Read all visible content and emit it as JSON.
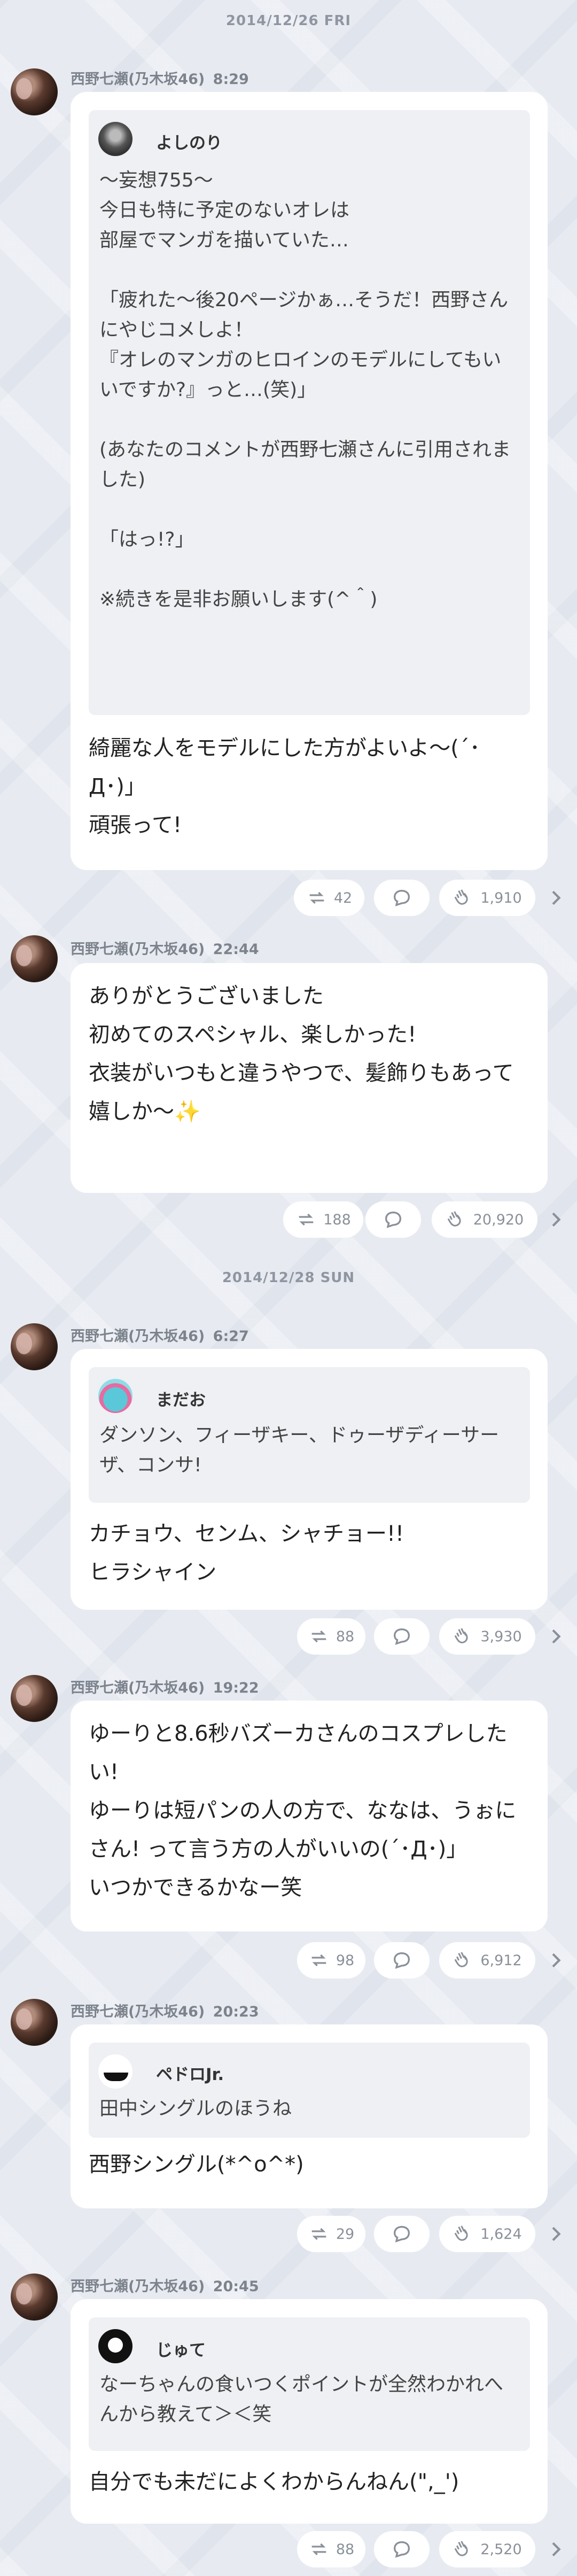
{
  "dates": [
    "2014/12/26 FRI",
    "2014/12/28 SUN"
  ],
  "messages": [
    {
      "author": "西野七瀬(乃木坂46)",
      "time": "8:29",
      "quote": {
        "user": "よしのり",
        "text": "～妄想755～\n今日も特に予定のないオレは\n部屋でマンガを描いていた…\n\n「疲れた～後20ページかぁ…そうだ！西野さんにやじコメしよ！\n『オレのマンガのヒロインのモデルにしてもいいですか?』っと…(笑)」\n\n(あなたのコメントが西野七瀬さんに引用されました)\n\n「はっ!?」\n\n※続きを是非お願いします(^＾)"
      },
      "text": "綺麗な人をモデルにした方がよいよ〜(´･Д･)」\n頑張って!",
      "repost": "42",
      "likes": "1,910"
    },
    {
      "author": "西野七瀬(乃木坂46)",
      "time": "22:44",
      "text": "ありがとうございました\n初めてのスペシャル、楽しかった!\n衣装がいつもと違うやつで、髪飾りもあって嬉しか〜✨",
      "repost": "188",
      "likes": "20,920"
    },
    {
      "author": "西野七瀬(乃木坂46)",
      "time": "6:27",
      "quote": {
        "user": "まだお",
        "text": "ダンソン、フィーザキー、ドゥーザディーサーザ、コンサ!"
      },
      "text": "カチョウ、センム、シャチョー!!\nヒラシャイン",
      "repost": "88",
      "likes": "3,930"
    },
    {
      "author": "西野七瀬(乃木坂46)",
      "time": "19:22",
      "text": "ゆーりと8.6秒バズーカさんのコスプレしたい!\nゆーりは短パンの人の方で、ななは、うぉにさん! って言う方の人がいいの(´･Д･)」\nいつかできるかなー笑",
      "repost": "98",
      "likes": "6,912"
    },
    {
      "author": "西野七瀬(乃木坂46)",
      "time": "20:23",
      "quote": {
        "user": "ペドロJr.",
        "text": "田中シングルのほうね"
      },
      "text": "西野シングル(*^o^*)",
      "repost": "29",
      "likes": "1,624"
    },
    {
      "author": "西野七瀬(乃木坂46)",
      "time": "20:45",
      "quote": {
        "user": "じゅて",
        "text": "なーちゃんの食いつくポイントが全然わかれへんから教えて＞＜笑"
      },
      "text": "自分でも未だによくわからんねん(\",_')",
      "repost": "88",
      "likes": "2,520"
    }
  ],
  "icons": {
    "repost": "repost-icon",
    "comment": "comment-icon",
    "like": "clap-icon",
    "more": "chevron-right-icon"
  },
  "colors": {
    "background": "#e7ebf1",
    "bubble": "#ffffff",
    "quote": "#eef0f3",
    "meta": "#8a9099"
  }
}
